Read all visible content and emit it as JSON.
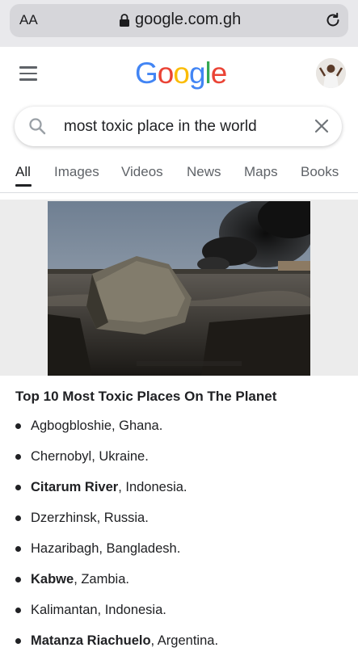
{
  "browser": {
    "aa_label": "AA",
    "url": "google.com.gh"
  },
  "header": {
    "logo_letters": [
      {
        "char": "G",
        "color": "#4285F4"
      },
      {
        "char": "o",
        "color": "#EA4335"
      },
      {
        "char": "o",
        "color": "#FBBC05"
      },
      {
        "char": "g",
        "color": "#4285F4"
      },
      {
        "char": "l",
        "color": "#34A853"
      },
      {
        "char": "e",
        "color": "#EA4335"
      }
    ]
  },
  "search": {
    "query": "most toxic place in the world"
  },
  "tabs": [
    {
      "label": "All",
      "active": true
    },
    {
      "label": "Images",
      "active": false
    },
    {
      "label": "Videos",
      "active": false
    },
    {
      "label": "News",
      "active": false
    },
    {
      "label": "Maps",
      "active": false
    },
    {
      "label": "Books",
      "active": false
    }
  ],
  "result": {
    "title": "Top 10 Most Toxic Places On The Planet",
    "items": [
      {
        "bold": "",
        "text": "Agbogbloshie, Ghana."
      },
      {
        "bold": "",
        "text": "Chernobyl, Ukraine."
      },
      {
        "bold": "Citarum River",
        "text": ", Indonesia."
      },
      {
        "bold": "",
        "text": "Dzerzhinsk, Russia."
      },
      {
        "bold": "",
        "text": "Hazaribagh, Bangladesh."
      },
      {
        "bold": "Kabwe",
        "text": ", Zambia."
      },
      {
        "bold": "",
        "text": "Kalimantan, Indonesia."
      },
      {
        "bold": "Matanza Riachuelo",
        "text": ", Argentina."
      }
    ]
  }
}
